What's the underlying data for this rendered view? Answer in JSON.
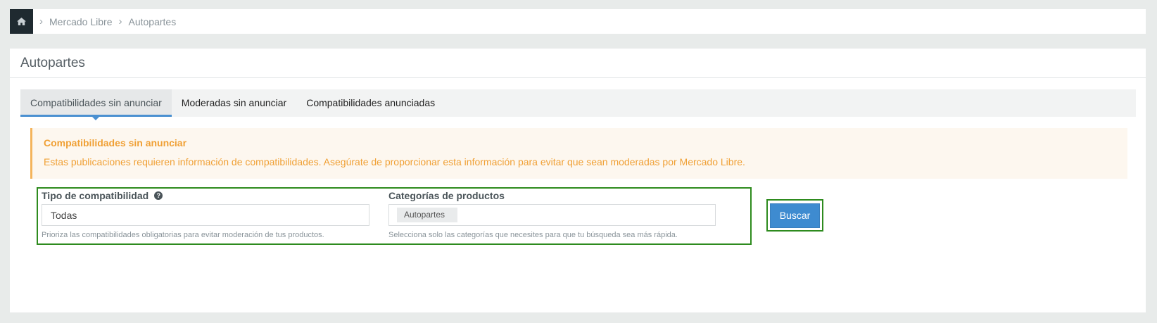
{
  "breadcrumb": {
    "home_icon": "home-icon",
    "items": [
      "Mercado Libre",
      "Autopartes"
    ]
  },
  "page": {
    "title": "Autopartes"
  },
  "tabs": [
    {
      "label": "Compatibilidades sin anunciar",
      "active": true
    },
    {
      "label": "Moderadas sin anunciar",
      "active": false
    },
    {
      "label": "Compatibilidades anunciadas",
      "active": false
    }
  ],
  "alert": {
    "title": "Compatibilidades sin anunciar",
    "text": "Estas publicaciones requieren información de compatibilidades. Asegúrate de proporcionar esta información para evitar que sean moderadas por Mercado Libre."
  },
  "filters": {
    "tipo": {
      "label": "Tipo de compatibilidad",
      "value": "Todas",
      "help": "Prioriza las compatibilidades obligatorias para evitar moderación de tus productos."
    },
    "categorias": {
      "label": "Categorías de productos",
      "tag": "Autopartes",
      "help": "Selecciona solo las categorías que necesites para que tu búsqueda sea más rápida."
    },
    "search_label": "Buscar"
  },
  "colors": {
    "accent": "#3e8bd0",
    "alert": "#f0a035",
    "highlight": "#2e8b1e",
    "nav_dark": "#1f2a30"
  }
}
